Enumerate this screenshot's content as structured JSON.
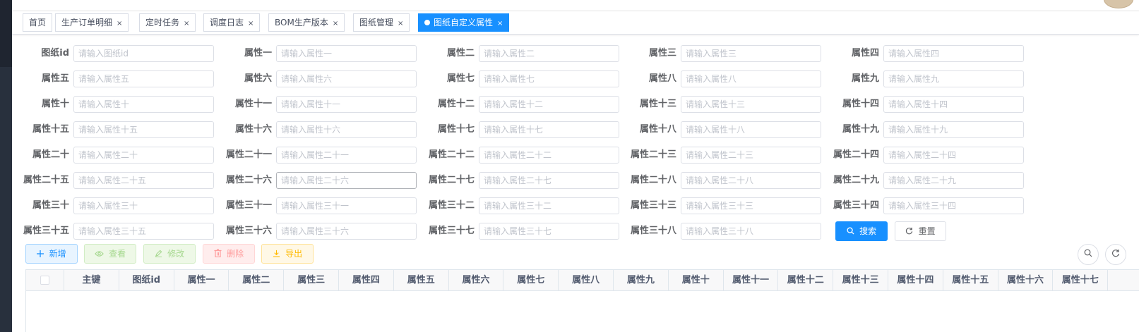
{
  "tabs": [
    {
      "label": "首页",
      "closable": false,
      "active": false
    },
    {
      "label": "生产订单明细",
      "closable": true,
      "active": false
    },
    {
      "label": "定时任务",
      "closable": true,
      "active": false
    },
    {
      "label": "调度日志",
      "closable": true,
      "active": false
    },
    {
      "label": "BOM生产版本",
      "closable": true,
      "active": false
    },
    {
      "label": "图纸管理",
      "closable": true,
      "active": false
    },
    {
      "label": "图纸自定义属性",
      "closable": true,
      "active": true
    }
  ],
  "tab_close_glyph": "×",
  "form_fields": [
    {
      "label": "图纸id",
      "placeholder": "请输入图纸id"
    },
    {
      "label": "属性一",
      "placeholder": "请输入属性一"
    },
    {
      "label": "属性二",
      "placeholder": "请输入属性二"
    },
    {
      "label": "属性三",
      "placeholder": "请输入属性三"
    },
    {
      "label": "属性四",
      "placeholder": "请输入属性四"
    },
    {
      "label": "属性五",
      "placeholder": "请输入属性五"
    },
    {
      "label": "属性六",
      "placeholder": "请输入属性六"
    },
    {
      "label": "属性七",
      "placeholder": "请输入属性七"
    },
    {
      "label": "属性八",
      "placeholder": "请输入属性八"
    },
    {
      "label": "属性九",
      "placeholder": "请输入属性九"
    },
    {
      "label": "属性十",
      "placeholder": "请输入属性十"
    },
    {
      "label": "属性十一",
      "placeholder": "请输入属性十一"
    },
    {
      "label": "属性十二",
      "placeholder": "请输入属性十二"
    },
    {
      "label": "属性十三",
      "placeholder": "请输入属性十三"
    },
    {
      "label": "属性十四",
      "placeholder": "请输入属性十四"
    },
    {
      "label": "属性十五",
      "placeholder": "请输入属性十五"
    },
    {
      "label": "属性十六",
      "placeholder": "请输入属性十六"
    },
    {
      "label": "属性十七",
      "placeholder": "请输入属性十七"
    },
    {
      "label": "属性十八",
      "placeholder": "请输入属性十八"
    },
    {
      "label": "属性十九",
      "placeholder": "请输入属性十九"
    },
    {
      "label": "属性二十",
      "placeholder": "请输入属性二十"
    },
    {
      "label": "属性二十一",
      "placeholder": "请输入属性二十一"
    },
    {
      "label": "属性二十二",
      "placeholder": "请输入属性二十二"
    },
    {
      "label": "属性二十三",
      "placeholder": "请输入属性二十三"
    },
    {
      "label": "属性二十四",
      "placeholder": "请输入属性二十四"
    },
    {
      "label": "属性二十五",
      "placeholder": "请输入属性二十五"
    },
    {
      "label": "属性二十六",
      "placeholder": "请输入属性二十六"
    },
    {
      "label": "属性二十七",
      "placeholder": "请输入属性二十七"
    },
    {
      "label": "属性二十八",
      "placeholder": "请输入属性二十八"
    },
    {
      "label": "属性二十九",
      "placeholder": "请输入属性二十九"
    },
    {
      "label": "属性三十",
      "placeholder": "请输入属性三十"
    },
    {
      "label": "属性三十一",
      "placeholder": "请输入属性三十一"
    },
    {
      "label": "属性三十二",
      "placeholder": "请输入属性三十二"
    },
    {
      "label": "属性三十三",
      "placeholder": "请输入属性三十三"
    },
    {
      "label": "属性三十四",
      "placeholder": "请输入属性三十四"
    },
    {
      "label": "属性三十五",
      "placeholder": "请输入属性三十五"
    },
    {
      "label": "属性三十六",
      "placeholder": "请输入属性三十六"
    },
    {
      "label": "属性三十七",
      "placeholder": "请输入属性三十七"
    },
    {
      "label": "属性三十八",
      "placeholder": "请输入属性三十八"
    }
  ],
  "search_button": {
    "label": "搜索",
    "icon": "search-icon"
  },
  "reset_button": {
    "label": "重置",
    "icon": "refresh-icon"
  },
  "toolbar": {
    "add": {
      "label": "新增",
      "icon": "plus-icon"
    },
    "view": {
      "label": "查看",
      "icon": "eye-icon"
    },
    "edit": {
      "label": "修改",
      "icon": "edit-icon"
    },
    "delete": {
      "label": "删除",
      "icon": "delete-icon"
    },
    "export": {
      "label": "导出",
      "icon": "download-icon"
    }
  },
  "right_tools": [
    {
      "icon": "search-icon"
    },
    {
      "icon": "refresh-icon"
    }
  ],
  "table": {
    "columns": [
      "主键",
      "图纸id",
      "属性一",
      "属性二",
      "属性三",
      "属性四",
      "属性五",
      "属性六",
      "属性七",
      "属性八",
      "属性九",
      "属性十",
      "属性十一",
      "属性十二",
      "属性十三",
      "属性十四",
      "属性十五",
      "属性十六",
      "属性十七"
    ],
    "rows": []
  },
  "colors": {
    "primary": "#1890ff",
    "success_plain": "#a6d88f",
    "danger_plain": "#ff9c9c",
    "warning_plain": "#ffba00",
    "sidebar": "#28303d"
  }
}
